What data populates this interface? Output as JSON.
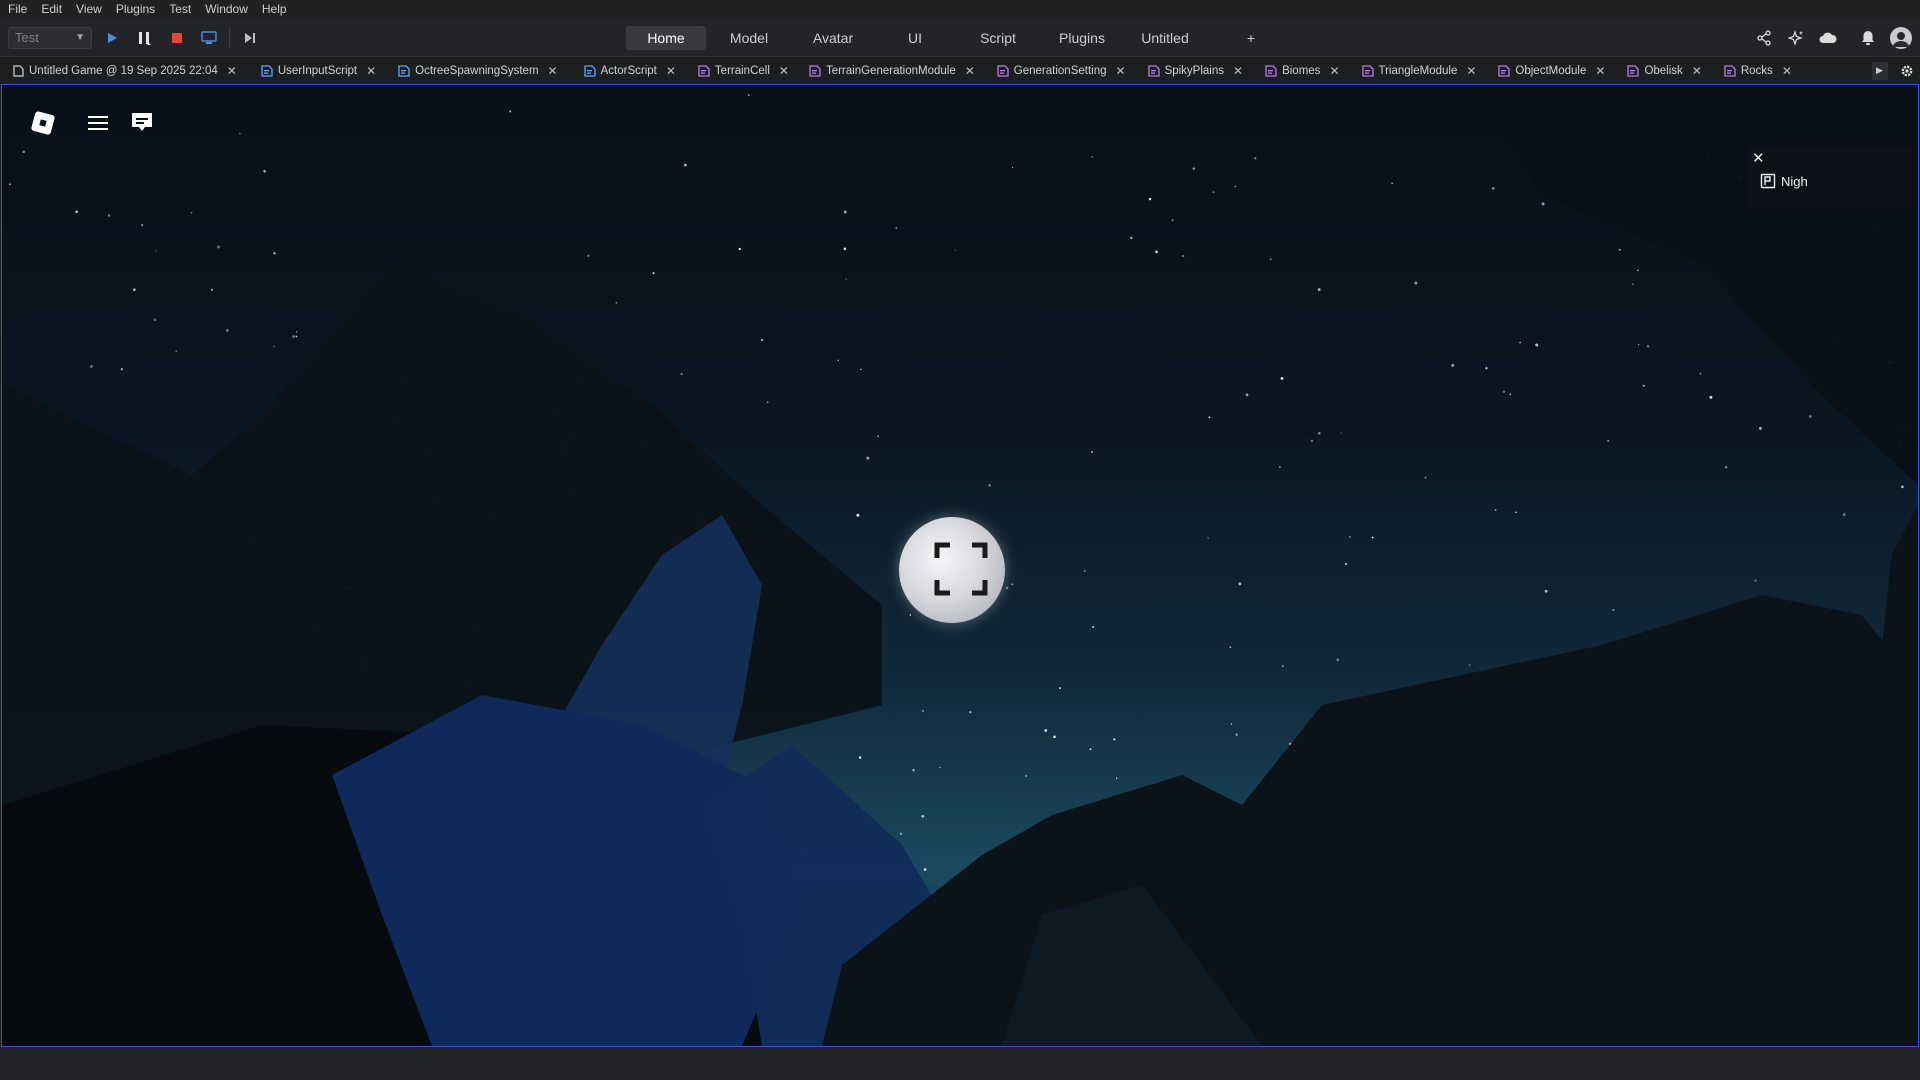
{
  "menubar": {
    "items": [
      "File",
      "Edit",
      "View",
      "Plugins",
      "Test",
      "Window",
      "Help"
    ]
  },
  "toolbar": {
    "mode_value": "Test",
    "icons": [
      "play-icon",
      "pause-icon",
      "stop-icon",
      "client-server-icon",
      "step-icon"
    ]
  },
  "ribbon": {
    "tabs": [
      {
        "label": "Home",
        "active": true
      },
      {
        "label": "Model",
        "active": false
      },
      {
        "label": "Avatar",
        "active": false
      },
      {
        "label": "UI",
        "active": false
      },
      {
        "label": "Script",
        "active": false
      },
      {
        "label": "Plugins",
        "active": false
      },
      {
        "label": "Untitled",
        "active": false
      },
      {
        "label": "+",
        "active": false
      }
    ],
    "right_icons": [
      "share-icon",
      "assistant-icon",
      "cloud-icon",
      "bell-icon",
      "avatar"
    ]
  },
  "doc_tabs": [
    {
      "label": "Untitled Game @ 19 Sep 2025 22:04",
      "icon": "place-document-icon",
      "color": "#d0d0d0"
    },
    {
      "label": "UserInputScript",
      "icon": "local-script-icon",
      "color": "#5ea6ff"
    },
    {
      "label": "OctreeSpawningSystem",
      "icon": "local-script-icon",
      "color": "#5ea6ff"
    },
    {
      "label": "ActorScript",
      "icon": "local-script-icon",
      "color": "#5ea6ff"
    },
    {
      "label": "TerrainCell",
      "icon": "module-script-icon",
      "color": "#b77cf0"
    },
    {
      "label": "TerrainGenerationModule",
      "icon": "module-script-icon",
      "color": "#b77cf0"
    },
    {
      "label": "GenerationSetting",
      "icon": "module-script-icon",
      "color": "#b77cf0"
    },
    {
      "label": "SpikyPlains",
      "icon": "module-script-icon",
      "color": "#b77cf0"
    },
    {
      "label": "Biomes",
      "icon": "module-script-icon",
      "color": "#b77cf0"
    },
    {
      "label": "TriangleModule",
      "icon": "module-script-icon",
      "color": "#b77cf0"
    },
    {
      "label": "ObjectModule",
      "icon": "module-script-icon",
      "color": "#b77cf0"
    },
    {
      "label": "Obelisk",
      "icon": "module-script-icon",
      "color": "#b77cf0"
    },
    {
      "label": "Rocks",
      "icon": "module-script-icon",
      "color": "#b77cf0"
    }
  ],
  "viewport": {
    "side_panel_item": "Nigh",
    "accent_border": "#3f4be8"
  },
  "colors": {
    "stop_red": "#e8453c",
    "play_blue": "#4f8ae0"
  }
}
